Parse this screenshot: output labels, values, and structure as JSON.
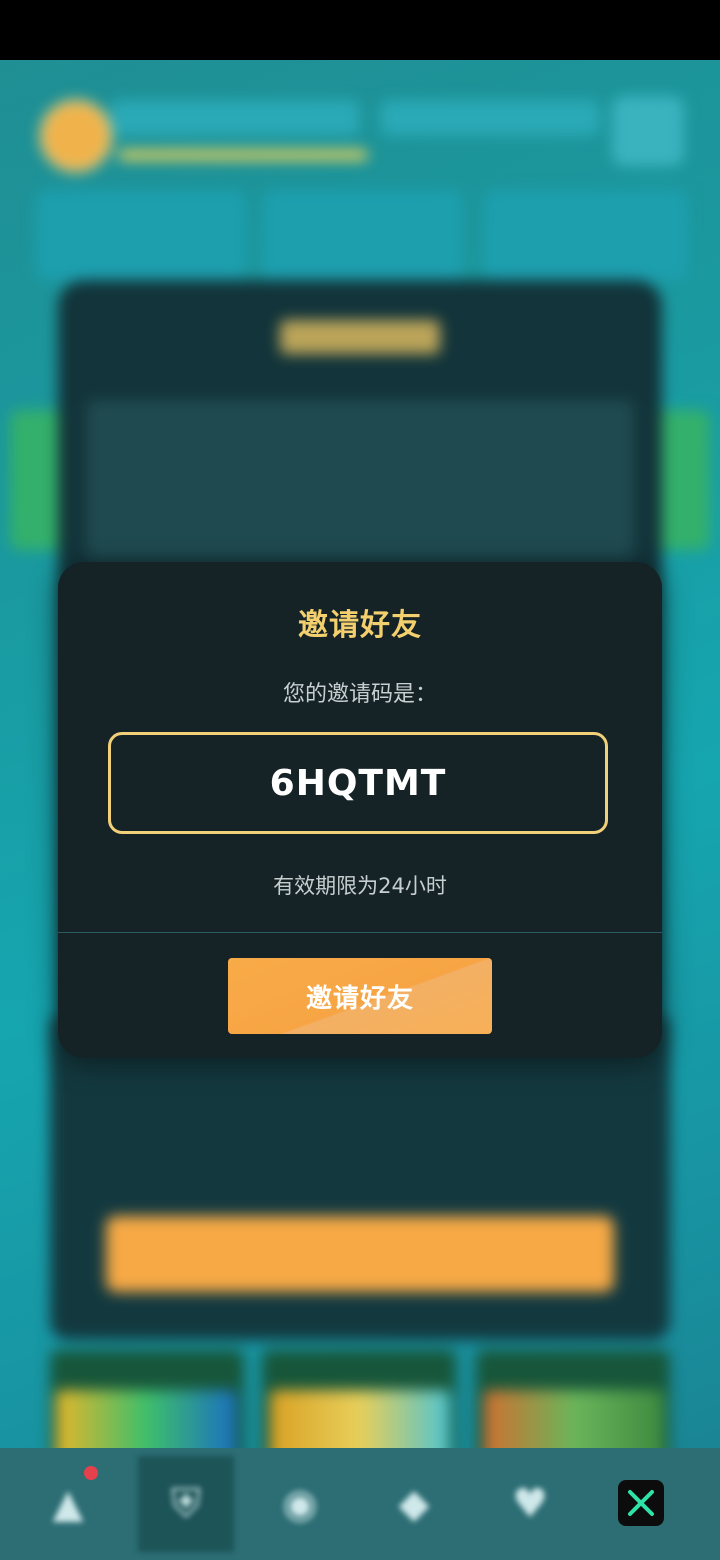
{
  "dialog": {
    "title": "邀请好友",
    "subtitle": "您的邀请码是：",
    "invite_code": "6HQTMT",
    "validity": "有效期限为24小时",
    "button_label": "邀请好友"
  },
  "bottom_nav": {
    "items": [
      {
        "icon": "triangle-icon",
        "glyph": "▲",
        "badge": true
      },
      {
        "icon": "shield-icon",
        "glyph": "⛨",
        "active": true
      },
      {
        "icon": "compass-icon",
        "glyph": "◉"
      },
      {
        "icon": "gem-icon",
        "glyph": "◆"
      },
      {
        "icon": "heart-icon",
        "glyph": "♥"
      }
    ]
  },
  "colors": {
    "accent_gold": "#f3cf6e",
    "button_orange": "#f7a544",
    "dialog_bg": "#152327"
  }
}
